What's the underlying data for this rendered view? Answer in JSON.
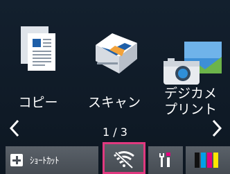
{
  "apps": [
    {
      "label": "コピー",
      "icon": "copy-icon"
    },
    {
      "label": "スキャン",
      "icon": "scan-icon"
    },
    {
      "label": "デジカメ\nプリント",
      "icon": "photo-print-icon"
    }
  ],
  "pager": {
    "text": "1 / 3",
    "current": 1,
    "total": 3
  },
  "bottom_bar": {
    "shortcut_label": "ｼｮｰﾄｶｯﾄ",
    "wifi_icon": "wifi-disabled-icon",
    "tools_icon": "tools-icon",
    "ink_icon": "ink-icon"
  },
  "colors": {
    "highlight": "#e0397f",
    "ink_black": "#111111",
    "ink_cyan": "#00a0e9",
    "ink_magenta": "#e4007f",
    "ink_yellow": "#ffe600"
  }
}
